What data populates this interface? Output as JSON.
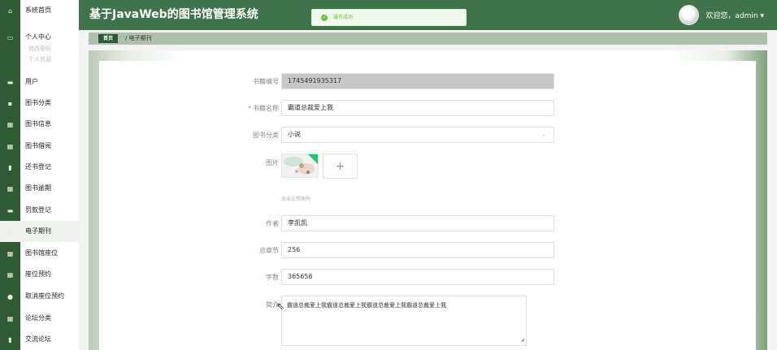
{
  "header": {
    "title": "基于JavaWeb的图书馆管理系统",
    "toast": "操作成功",
    "welcome": "欢迎您，admin ▾"
  },
  "sidebar": {
    "items": [
      {
        "label": "系统首页",
        "icon": "home-icon"
      },
      {
        "label": "个人中心",
        "icon": "user-card-icon"
      },
      {
        "label": "用户",
        "icon": "users-icon"
      },
      {
        "label": "图书分类",
        "icon": "category-icon"
      },
      {
        "label": "图书信息",
        "icon": "grid-icon"
      },
      {
        "label": "图书借阅",
        "icon": "grid-icon"
      },
      {
        "label": "还书登记",
        "icon": "doc-icon"
      },
      {
        "label": "图书逾期",
        "icon": "grid-icon"
      },
      {
        "label": "罚款登记",
        "icon": "money-icon"
      },
      {
        "label": "电子期刊",
        "icon": "grid-icon"
      },
      {
        "label": "图书馆座位",
        "icon": "grid-icon"
      },
      {
        "label": "座位预约",
        "icon": "grid-icon"
      },
      {
        "label": "取消座位预约",
        "icon": "pin-icon"
      },
      {
        "label": "论坛分类",
        "icon": "grid-icon"
      },
      {
        "label": "交流论坛",
        "icon": "doc-icon"
      }
    ],
    "sub_items": [
      "修改密码",
      "个人信息"
    ]
  },
  "breadcrumb": {
    "home": "首页",
    "current": "/ 电子期刊"
  },
  "form": {
    "book_no_label": "书籍编号",
    "book_no_value": "1745491935317",
    "book_name_label": "书籍名称",
    "book_name_value": "霸道总裁爱上我",
    "category_label": "图书分类",
    "category_value": "小说",
    "image_label": "图片",
    "upload_hint": "点击上传图片",
    "author_label": "作者",
    "author_value": "李凯凯",
    "chapters_label": "总章节",
    "chapters_value": "256",
    "words_label": "字数",
    "words_value": "365656",
    "intro_label": "简介",
    "intro_value": "霸道总裁爱上我霸道总裁爱上我霸道总裁爱上我霸道总裁爱上我"
  },
  "colors": {
    "header": "#3f7349",
    "sidebar_icon_column": "#2e5a36",
    "breadcrumb_bar": "#aebfaa",
    "toast_text": "#67c23a",
    "required_mark": "#f56c6c"
  }
}
